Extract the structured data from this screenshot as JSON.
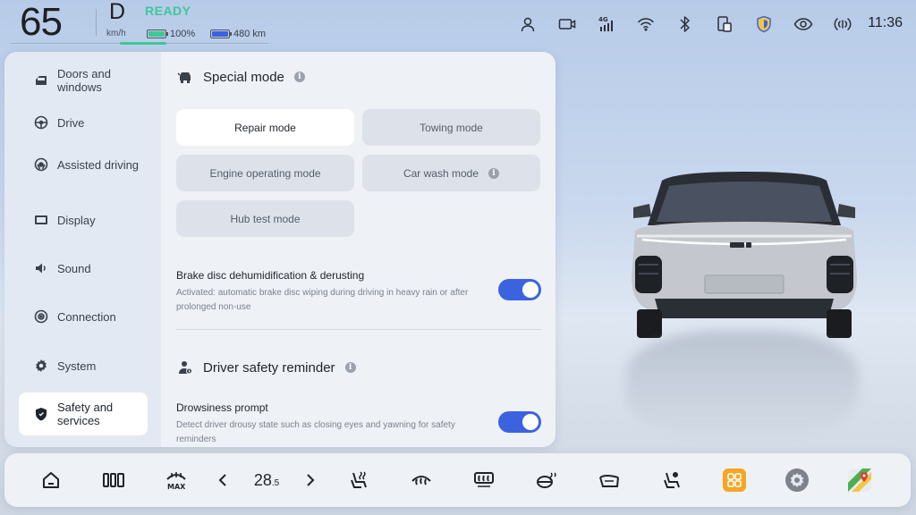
{
  "status": {
    "speed": "65",
    "speed_unit": "km/h",
    "gear": "D",
    "ready_label": "READY",
    "ready_color": "#3fc79a",
    "battery_percent": "100%",
    "battery_fill": 1.0,
    "range": "480 km",
    "clock": "11:36",
    "icons": [
      "user-icon",
      "camera-icon",
      "4g-signal-icon",
      "wifi-icon",
      "bluetooth-icon",
      "phone-screen-icon",
      "shield-icon",
      "eye-icon",
      "hotspot-icon"
    ],
    "network_label": "4G"
  },
  "sidebar": {
    "items": [
      {
        "label": "Doors and windows",
        "icon": "door-icon"
      },
      {
        "label": "Drive",
        "icon": "steering-wheel-icon"
      },
      {
        "label": "Assisted driving",
        "icon": "assisted-driving-icon"
      },
      {
        "label": "Display",
        "icon": "display-icon"
      },
      {
        "label": "Sound",
        "icon": "speaker-icon"
      },
      {
        "label": "Connection",
        "icon": "connection-icon"
      },
      {
        "label": "System",
        "icon": "gear-icon"
      },
      {
        "label": "Safety and services",
        "icon": "shield-icon",
        "active": true
      }
    ]
  },
  "special_mode": {
    "title": "Special mode",
    "modes": [
      {
        "label": "Repair mode",
        "selected": true
      },
      {
        "label": "Towing mode",
        "selected": false
      },
      {
        "label": "Engine operating mode",
        "selected": false
      },
      {
        "label": "Car wash mode",
        "selected": false,
        "has_info": true
      },
      {
        "label": "Hub test mode",
        "selected": false
      }
    ]
  },
  "brake_disc": {
    "title": "Brake disc dehumidification & derusting",
    "desc": "Activated: automatic brake disc wiping during driving in heavy rain or after prolonged non-use",
    "enabled": true
  },
  "driver_safety": {
    "title": "Driver safety reminder",
    "drowsiness_title": "Drowsiness prompt",
    "drowsiness_desc": "Detect driver drousy state such as closing eyes and yawning for safety reminders",
    "drowsiness_enabled": true
  },
  "dock": {
    "temperature_int": "28",
    "temperature_dec": ".5",
    "items": [
      "home-icon",
      "split-screen-icon",
      "max-defrost-icon",
      "seat-heat-icon",
      "front-defrost-icon",
      "rear-defrost-icon",
      "steering-heat-icon",
      "seat-ventilation-icon",
      "seat-massage-icon",
      "apps-icon",
      "settings-icon",
      "navigation-icon"
    ]
  },
  "colors": {
    "accent": "#3b63e0",
    "apps_orange": "#f5a623"
  }
}
